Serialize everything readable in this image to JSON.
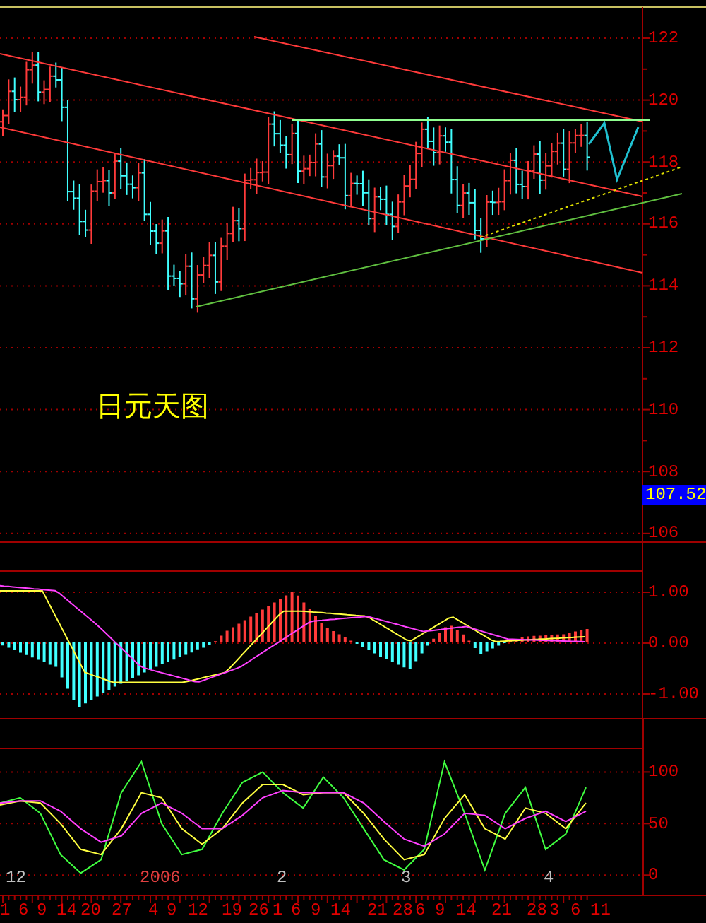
{
  "main_panel": {
    "title": "日元天图",
    "price_ticks": [
      "122",
      "120",
      "118",
      "116",
      "114",
      "112",
      "110",
      "108",
      "106"
    ],
    "current_price": "107.52"
  },
  "macd_panel": {
    "ticks": [
      "1.00",
      "0.00",
      "-1.00"
    ]
  },
  "kdj_panel": {
    "chart_data": {
      "type": "line",
      "ylim": [
        -19,
        151
      ],
      "grid": true,
      "yticks": [
        {
          "value": 100,
          "label": "100"
        },
        {
          "value": 50,
          "label": "50"
        },
        {
          "value": 0,
          "label": "0"
        }
      ],
      "series": [
        {
          "color": "#40ff40",
          "values": [
            70,
            75,
            60,
            20,
            2,
            15,
            80,
            110,
            50,
            20,
            25,
            60,
            90,
            100,
            80,
            65,
            95,
            75,
            45,
            15,
            5,
            25,
            110,
            60,
            5,
            60,
            85,
            25,
            40,
            85
          ]
        },
        {
          "color": "#ffff40",
          "values": [
            68,
            72,
            70,
            50,
            25,
            20,
            45,
            80,
            75,
            45,
            30,
            45,
            70,
            88,
            88,
            78,
            80,
            80,
            60,
            35,
            15,
            20,
            55,
            78,
            45,
            35,
            65,
            60,
            45,
            70
          ]
        },
        {
          "color": "#ff40ff",
          "values": [
            70,
            72,
            72,
            62,
            45,
            32,
            38,
            60,
            70,
            60,
            45,
            45,
            58,
            75,
            82,
            80,
            80,
            80,
            70,
            52,
            35,
            28,
            40,
            60,
            58,
            45,
            55,
            62,
            52,
            62
          ]
        }
      ]
    },
    "month_labels": [
      {
        "label": "12",
        "color": "#c0c0c0"
      },
      {
        "label": "2006",
        "color": "#e04040"
      },
      {
        "label": "2",
        "color": "#c0c0c0"
      },
      {
        "label": "3",
        "color": "#c0c0c0"
      },
      {
        "label": "4",
        "color": "#c0c0c0"
      }
    ]
  },
  "date_axis": {
    "day_labels": [
      "1",
      "6",
      "9",
      "14",
      "20",
      "27",
      "4",
      "9",
      "12",
      "19",
      "26",
      "1",
      "6",
      "9",
      "14",
      "21",
      "28",
      "6",
      "9",
      "14",
      "21",
      "28",
      "3",
      "6",
      "11"
    ]
  }
}
